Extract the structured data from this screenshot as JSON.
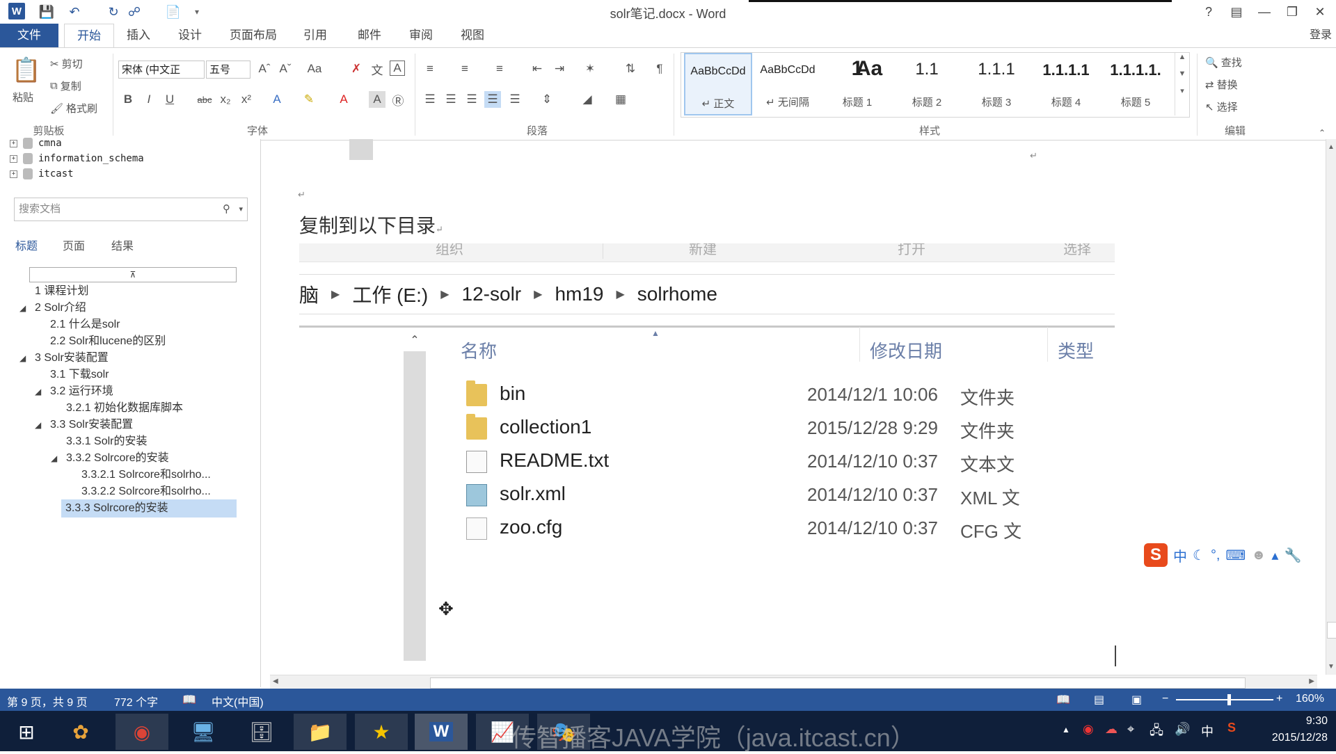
{
  "window": {
    "title": "solr笔记.docx - Word",
    "help": "?",
    "signin": "登录"
  },
  "qat": {
    "word": "W",
    "save": "💾",
    "undo": "↶",
    "redo": "↻"
  },
  "tabs": [
    "文件",
    "开始",
    "插入",
    "设计",
    "页面布局",
    "引用",
    "邮件",
    "审阅",
    "视图"
  ],
  "ribbon": {
    "clipboard": {
      "paste": "粘贴",
      "cut": "剪切",
      "copy": "复制",
      "format_painter": "格式刷",
      "label": "剪贴板"
    },
    "font": {
      "name": "宋体 (中文正",
      "size": "五号",
      "label": "字体"
    },
    "paragraph": {
      "label": "段落"
    },
    "styles": {
      "label": "样式",
      "items": [
        {
          "sample": "AaBbCcDd",
          "name": "↵ 正文"
        },
        {
          "sample": "AaBbCcDd",
          "name": "↵ 无间隔"
        },
        {
          "sample": "1",
          "name": "标题 1"
        },
        {
          "sample": "Aa",
          "name": "标题 2"
        },
        {
          "sample": "1.1",
          "name": "标题 3"
        },
        {
          "sample": "Aa",
          "name": "标题 4"
        },
        {
          "sample": "1.1.1",
          "name": "标题 5"
        }
      ],
      "extra": [
        "1.1.1.1",
        "1.1.1.1."
      ]
    },
    "editing": {
      "find": "查找",
      "replace": "替换",
      "select": "选择",
      "label": "编辑"
    }
  },
  "nav": {
    "databases": [
      "cmna",
      "information_schema",
      "itcast"
    ],
    "search_placeholder": "搜索文档",
    "tabs": [
      "标题",
      "页面",
      "结果"
    ],
    "headings": [
      "1 课程计划",
      "2 Solr介绍",
      "2.1 什么是solr",
      "2.2 Solr和lucene的区别",
      "3 Solr安装配置",
      "3.1 下载solr",
      "3.2 运行环境",
      "3.2.1 初始化数据库脚本",
      "3.3 Solr安装配置",
      "3.3.1 Solr的安装",
      "3.3.2 Solrcore的安装",
      "3.3.2.1 Solrcore和solrho...",
      "3.3.2.2 Solrcore和solrho...",
      "3.3.3 Solrcore的安装"
    ]
  },
  "document": {
    "heading_text": "复制到以下目录",
    "explorer": {
      "toolbar": [
        "组织",
        "新建",
        "打开",
        "选择"
      ],
      "breadcrumb": [
        "脑",
        "工作 (E:)",
        "12-solr",
        "hm19",
        "solrhome"
      ],
      "columns": [
        "名称",
        "修改日期",
        "类型"
      ],
      "files": [
        {
          "name": "bin",
          "date": "2014/12/1 10:06",
          "type": "文件夹",
          "icon": "folder"
        },
        {
          "name": "collection1",
          "date": "2015/12/28 9:29",
          "type": "文件夹",
          "icon": "folder"
        },
        {
          "name": "README.txt",
          "date": "2014/12/10 0:37",
          "type": "文本文",
          "icon": "text"
        },
        {
          "name": "solr.xml",
          "date": "2014/12/10 0:37",
          "type": "XML 文",
          "icon": "xml"
        },
        {
          "name": "zoo.cfg",
          "date": "2014/12/10 0:37",
          "type": "CFG 文",
          "icon": "file"
        }
      ]
    }
  },
  "ime": {
    "logo": "S",
    "mode": "中"
  },
  "status": {
    "page": "第 9 页，共 9 页",
    "words": "772 个字",
    "lang": "中文(中国)",
    "zoom": "160%"
  },
  "taskbar": {
    "watermark": "传智播客JAVA学院（java.itcast.cn）",
    "tray_lang": "中",
    "time": "9:30",
    "date": "2015/12/28"
  },
  "colors": {
    "accent": "#2b579a",
    "folder": "#e8c25a",
    "selection": "#c5dcf5"
  }
}
